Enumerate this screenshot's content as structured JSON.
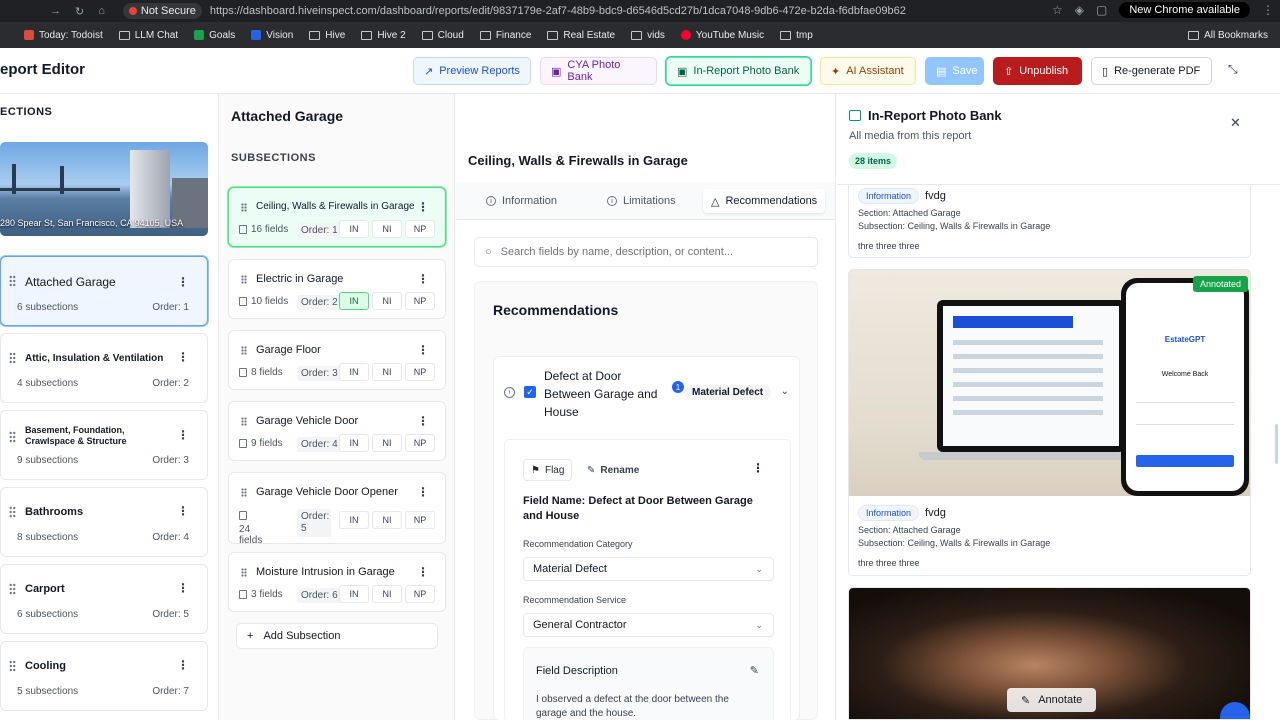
{
  "browser": {
    "security": "Not Secure",
    "url": "https://dashboard.hiveinspect.com/dashboard/reports/edit/9837179e-2af7-48b9-bdc9-d6546d5cd27b/1dca7048-9db6-472e-b2da-f6dbfae09b62",
    "new_chrome": "New Chrome available",
    "bookmarks": [
      {
        "label": "Today: Todoist",
        "icon": "todoist-icon"
      },
      {
        "label": "LLM Chat",
        "icon": "folder-icon"
      },
      {
        "label": "Goals",
        "icon": "sheets-icon"
      },
      {
        "label": "Vision",
        "icon": "docs-icon"
      },
      {
        "label": "Hive",
        "icon": "folder-icon"
      },
      {
        "label": "Hive 2",
        "icon": "folder-icon"
      },
      {
        "label": "Cloud",
        "icon": "folder-icon"
      },
      {
        "label": "Finance",
        "icon": "folder-icon"
      },
      {
        "label": "Real Estate",
        "icon": "folder-icon"
      },
      {
        "label": "vids",
        "icon": "folder-icon"
      },
      {
        "label": "YouTube Music",
        "icon": "youtube-music-icon"
      },
      {
        "label": "tmp",
        "icon": "folder-icon"
      }
    ],
    "all_bookmarks": "All Bookmarks"
  },
  "header": {
    "title": "eport Editor",
    "buttons": {
      "preview": "Preview Reports",
      "cya": "CYA Photo Bank",
      "in_report": "In-Report Photo Bank",
      "ai": "AI Assistant",
      "save": "Save",
      "unpublish": "Unpublish",
      "regenerate": "Re-generate PDF"
    }
  },
  "sections": {
    "heading": "ECTIONS",
    "address": "280 Spear St, San Francisco, CA 94105, USA",
    "items": [
      {
        "name": "Attached Garage",
        "subs": "6 subsections",
        "order": "Order: 1"
      },
      {
        "name": "Attic, Insulation & Ventilation",
        "subs": "4 subsections",
        "order": "Order: 2"
      },
      {
        "name": "Basement, Foundation, Crawlspace & Structure",
        "subs": "9 subsections",
        "order": "Order: 3"
      },
      {
        "name": "Bathrooms",
        "subs": "8 subsections",
        "order": "Order: 4"
      },
      {
        "name": "Carport",
        "subs": "6 subsections",
        "order": "Order: 5"
      },
      {
        "name": "Cooling",
        "subs": "5 subsections",
        "order": "Order: 7"
      }
    ]
  },
  "subsections": {
    "section_title": "Attached Garage",
    "heading": "SUBSECTIONS",
    "items": [
      {
        "name": "Ceiling, Walls & Firewalls in Garage",
        "fields": "16 fields",
        "order": "Order: 1"
      },
      {
        "name": "Electric in Garage",
        "fields": "10 fields",
        "order": "Order: 2"
      },
      {
        "name": "Garage Floor",
        "fields": "8 fields",
        "order": "Order: 3"
      },
      {
        "name": "Garage Vehicle Door",
        "fields": "9 fields",
        "order": "Order: 4"
      },
      {
        "name": "Garage Vehicle Door Opener",
        "fields": "24 fields",
        "order": "Order: 5"
      },
      {
        "name": "Moisture Intrusion in Garage",
        "fields": "3 fields",
        "order": "Order: 6"
      }
    ],
    "status_labels": [
      "IN",
      "NI",
      "NP"
    ],
    "add_label": "Add Subsection"
  },
  "editor": {
    "subsection_title": "Ceiling, Walls & Firewalls in Garage",
    "tabs": [
      "Information",
      "Limitations",
      "Recommendations"
    ],
    "search_placeholder": "Search fields by name, description, or content...",
    "panel_title": "Recommendations",
    "rec": {
      "name": "Defect at Door Between Garage and House",
      "count": "1",
      "category_pill": "Material Defect",
      "flag": "Flag",
      "rename": "Rename",
      "field_name": "Field Name: Defect at Door Between Garage and House",
      "category_label": "Recommendation Category",
      "category_value": "Material Defect",
      "service_label": "Recommendation Service",
      "service_value": "General Contractor",
      "desc_label": "Field Description",
      "desc_text": "I observed a defect at the door between the garage and the house."
    }
  },
  "photo_bank": {
    "title": "In-Report Photo Bank",
    "subtitle": "All media from this report",
    "count": "28 items",
    "cards": [
      {
        "tag": "Information",
        "caption": "fvdg",
        "section": "Attached Garage",
        "subsection": "Ceiling, Walls & Firewalls in Garage",
        "note": "thre three three"
      },
      {
        "badge": "Annotated",
        "tag": "Information",
        "caption": "fvdg",
        "section": "Attached Garage",
        "subsection": "Ceiling, Walls & Firewalls in Garage",
        "note": "thre three three",
        "phone_brand": "EstateGPT",
        "phone_welcome": "Welcome Back"
      },
      {
        "annotate": "Annotate"
      }
    ],
    "section_label": "Section:",
    "subsection_label": "Subsection:"
  },
  "colors": {
    "accent": "#2563eb",
    "unpublish": "#b91c1c",
    "success": "#16a34a"
  }
}
